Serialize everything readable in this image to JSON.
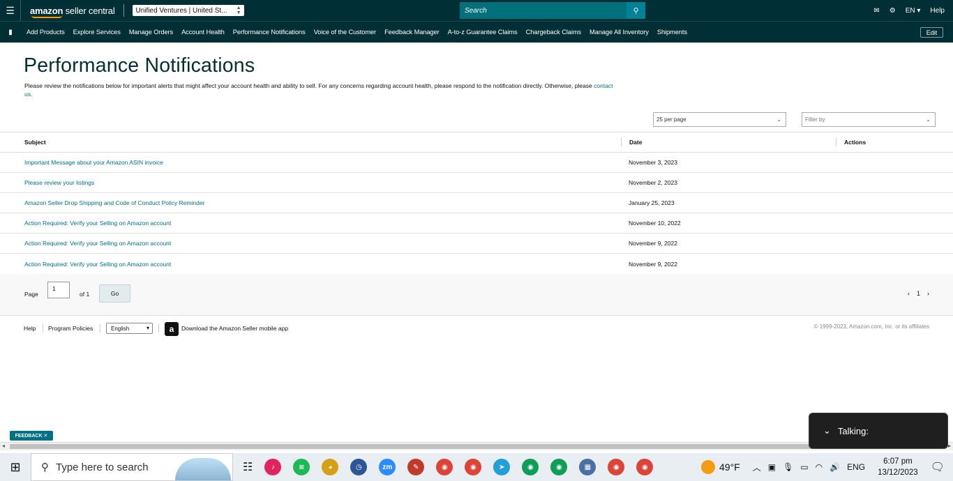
{
  "header": {
    "logo_bold": "amazon",
    "logo_rest": " seller central",
    "account": "Unified Ventures | United St...",
    "search_placeholder": "Search",
    "language": "EN",
    "help": "Help"
  },
  "nav": {
    "items": [
      "Add Products",
      "Explore Services",
      "Manage Orders",
      "Account Health",
      "Performance Notifications",
      "Voice of the Customer",
      "Feedback Manager",
      "A-to-z Guarantee Claims",
      "Chargeback Claims",
      "Manage All Inventory",
      "Shipments"
    ],
    "edit": "Edit"
  },
  "page": {
    "title": "Performance Notifications",
    "description": "Please review the notifications below for important alerts that might affect your account health and ability to sell. For any concerns regarding account health, please respond to the notification directly. Otherwise, please ",
    "contact_link": "contact us",
    "contact_suffix": ".",
    "per_page": "25 per page",
    "filter_placeholder": "Filter by"
  },
  "table": {
    "headers": {
      "subject": "Subject",
      "date": "Date",
      "actions": "Actions"
    },
    "rows": [
      {
        "subject": "Important Message about your Amazon ASIN invoice",
        "date": "November 3, 2023"
      },
      {
        "subject": "Please review your listings",
        "date": "November 2, 2023"
      },
      {
        "subject": "Amazon Seller Drop Shipping and Code of Conduct Policy Reminder",
        "date": "January 25, 2023"
      },
      {
        "subject": "Action Required: Verify your Selling on Amazon account",
        "date": "November 10, 2022"
      },
      {
        "subject": "Action Required: Verify your Selling on Amazon account",
        "date": "November 9, 2022"
      },
      {
        "subject": "Action Required: Verify your Selling on Amazon account",
        "date": "November 9, 2022"
      }
    ]
  },
  "pagination": {
    "page_label": "Page",
    "current": "1",
    "of_label": "of 1",
    "go": "Go",
    "page_number": "1"
  },
  "footer": {
    "help": "Help",
    "policies": "Program Policies",
    "language": "English",
    "app_icon_letter": "a",
    "app": "Download the Amazon Seller mobile app",
    "copyright": "© 1999-2023, Amazon.com, Inc. or its affiliates"
  },
  "feedback": "FEEDBACK",
  "talking": "Talking:",
  "taskbar": {
    "search_placeholder": "Type here to search",
    "apps": [
      {
        "name": "tiktok-icon",
        "label": "♪",
        "color": "#e0245e"
      },
      {
        "name": "spotify-icon",
        "label": "≋",
        "color": "#1db954"
      },
      {
        "name": "game-icon",
        "label": "◕",
        "color": "#d4a017"
      },
      {
        "name": "clock-app-icon",
        "label": "◷",
        "color": "#2b5797"
      },
      {
        "name": "zoom-icon",
        "label": "zm",
        "color": "#2d8cff"
      },
      {
        "name": "paint-icon",
        "label": "✎",
        "color": "#c0392b"
      },
      {
        "name": "chrome-icon",
        "label": "◉",
        "color": "#db4437"
      },
      {
        "name": "chrome-m-icon",
        "label": "◉",
        "color": "#db4437"
      },
      {
        "name": "telegram-icon",
        "label": "➤",
        "color": "#229ed9"
      },
      {
        "name": "chrome-m2-icon",
        "label": "◉",
        "color": "#0f9d58"
      },
      {
        "name": "chrome-l-icon",
        "label": "◉",
        "color": "#0f9d58"
      },
      {
        "name": "calculator-icon",
        "label": "▦",
        "color": "#4a6fa5"
      },
      {
        "name": "chrome-s-icon",
        "label": "◉",
        "color": "#db4437"
      },
      {
        "name": "chrome-r-icon",
        "label": "◉",
        "color": "#db4437"
      }
    ],
    "weather": "49°F",
    "lang": "ENG",
    "time": "6:07 pm",
    "date": "13/12/2023"
  }
}
